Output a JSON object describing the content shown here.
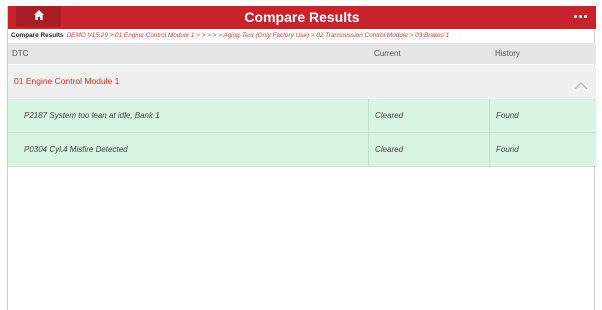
{
  "header": {
    "title": "Compare Results",
    "home_icon": "home-icon",
    "more_icon": "more-icon",
    "bar_color": "#c6232d"
  },
  "breadcrumb": {
    "label": "Compare Results",
    "path": "DEMO V15.29 > 01 Engine Control Module 1 > > > > > Aging-Test (Only Factory Use) > 02 Transmission Control Module > 03 Brakes 1"
  },
  "table": {
    "columns": [
      "DTC",
      "Current",
      "History"
    ],
    "groups": [
      {
        "label": "01 Engine Control Module 1",
        "expanded": true,
        "rows": [
          {
            "dtc": "P2187 System too lean at idle, Bank 1",
            "current": "Cleared",
            "history": "Found"
          },
          {
            "dtc": "P0304 Cyl.4 Misfire Detected",
            "current": "Cleared",
            "history": "Found"
          }
        ]
      }
    ]
  }
}
